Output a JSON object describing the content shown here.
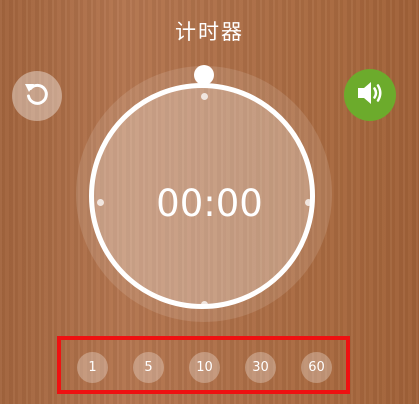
{
  "header": {
    "title": "计时器"
  },
  "controls": {
    "reset_icon": "reset-icon",
    "sound_icon": "speaker-icon",
    "sound_color": "#6cab2c"
  },
  "timer": {
    "display": "00:00",
    "progress": 0
  },
  "presets": {
    "items": [
      "1",
      "5",
      "10",
      "30",
      "60"
    ],
    "highlight_color": "#ee1111"
  }
}
